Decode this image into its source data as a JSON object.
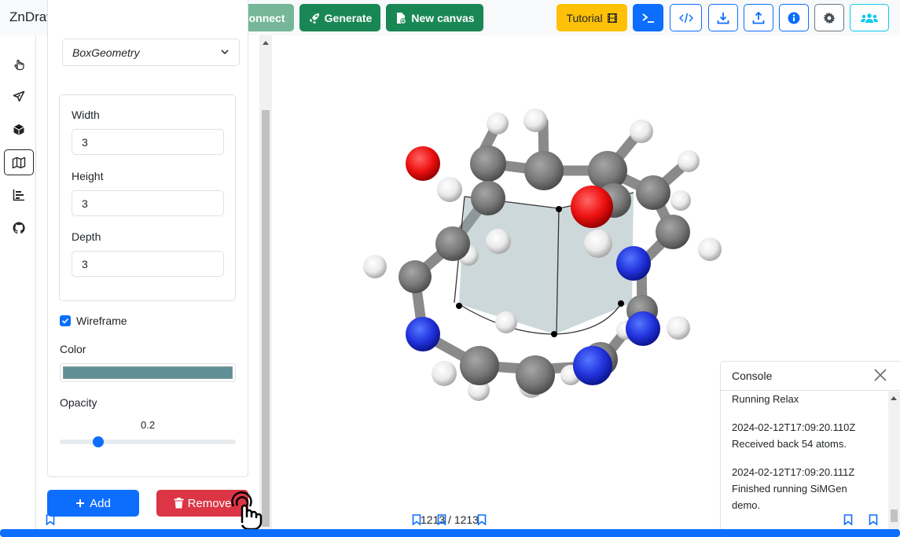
{
  "app": {
    "title": "ZnDraw + SiMGen"
  },
  "toolbar": {
    "connect_label": "Connect",
    "generate_label": "Generate",
    "new_canvas_label": "New canvas",
    "tutorial_label": "Tutorial",
    "colors": {
      "primary": "#0d6efd",
      "success": "#198754",
      "warning": "#ffc107",
      "danger": "#dc3545",
      "info": "#0dcaf0"
    }
  },
  "sidebar": {
    "icons": [
      "pointer-icon",
      "send-icon",
      "box-icon",
      "map-icon",
      "chart-icon",
      "github-icon"
    ],
    "active": "map-icon"
  },
  "geometry_panel": {
    "geometry_type": "BoxGeometry",
    "width_label": "Width",
    "width_value": "3",
    "height_label": "Height",
    "height_value": "3",
    "depth_label": "Depth",
    "depth_value": "3",
    "wireframe_label": "Wireframe",
    "wireframe_checked": true,
    "color_label": "Color",
    "color_value": "#5f8f97",
    "opacity_label": "Opacity",
    "opacity_value": "0.2",
    "add_label": "Add",
    "remove_label": "Remove"
  },
  "console": {
    "title": "Console",
    "lines": [
      "Running Relax",
      "2024-02-12T17:09:20.110Z",
      "Received back 54 atoms.",
      "2024-02-12T17:09:20.111Z",
      "Finished running SiMGen",
      "demo."
    ]
  },
  "frame": {
    "text": "1213 / 1213",
    "progress": 1.0
  }
}
